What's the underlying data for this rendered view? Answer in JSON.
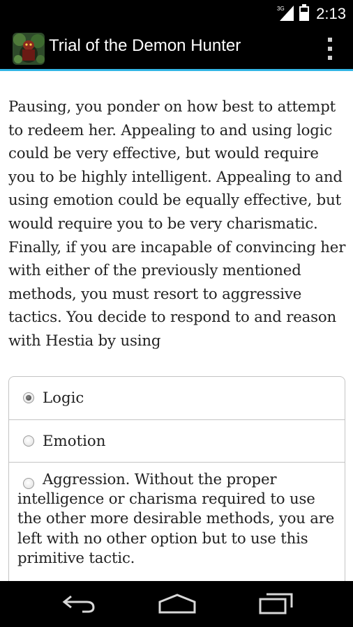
{
  "status_bar": {
    "network_label": "3G",
    "time": "2:13"
  },
  "action_bar": {
    "title": "Trial of the Demon Hunter",
    "accent_color": "#33b5e5"
  },
  "story": {
    "text": "Pausing, you ponder on how best to attempt to redeem her. Appealing to and using logic could be very effective, but would require you to be highly intelligent. Appealing to and using emotion could be equally effective, but would require you to be very charismatic. Finally, if you are incapable of convincing her with either of the previously mentioned methods, you must resort to aggressive tactics. You decide to respond to and reason with Hestia by using"
  },
  "choices": [
    {
      "label": "Logic",
      "checked": true
    },
    {
      "label": "Emotion",
      "checked": false
    },
    {
      "label": "Aggression. Without the proper intelligence or charisma required to use the other more desirable methods, you are left with no other option but to use this primitive tactic.",
      "checked": false
    }
  ],
  "nav_bar": {
    "icons": [
      "back-icon",
      "home-icon",
      "recent-apps-icon"
    ]
  }
}
